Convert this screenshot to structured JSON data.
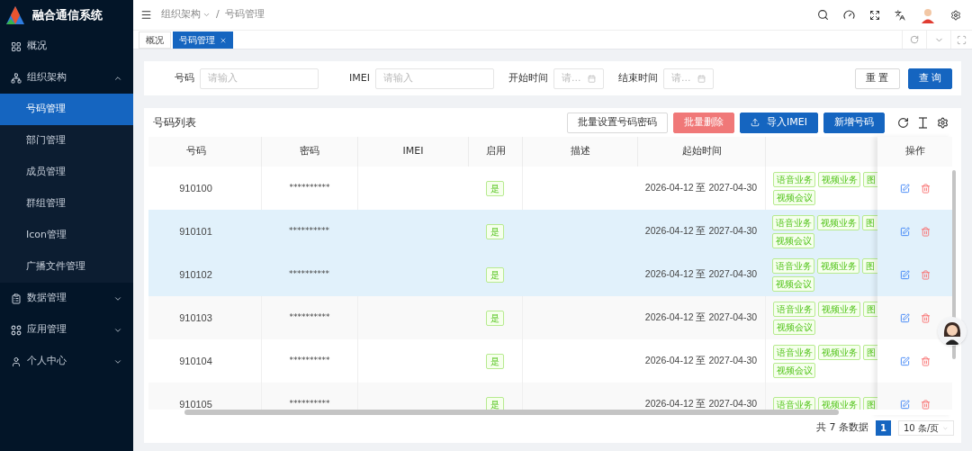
{
  "app": {
    "title": "融合通信系统"
  },
  "sidebar": {
    "items": [
      {
        "label": "概况",
        "selected": false
      },
      {
        "label": "组织架构",
        "selected": false,
        "expanded": true,
        "children": [
          {
            "label": "号码管理",
            "selected": true
          },
          {
            "label": "部门管理",
            "selected": false
          },
          {
            "label": "成员管理",
            "selected": false
          },
          {
            "label": "群组管理",
            "selected": false
          },
          {
            "label": "Icon管理",
            "selected": false
          },
          {
            "label": "广播文件管理",
            "selected": false
          }
        ]
      },
      {
        "label": "数据管理",
        "selected": false,
        "expanded": false
      },
      {
        "label": "应用管理",
        "selected": false,
        "expanded": false
      },
      {
        "label": "个人中心",
        "selected": false,
        "expanded": false
      }
    ]
  },
  "breadcrumb": {
    "items": [
      "组织架构",
      "号码管理"
    ],
    "separator": "/"
  },
  "tabs": [
    {
      "label": "概况",
      "selected": false,
      "closable": false
    },
    {
      "label": "号码管理",
      "selected": true,
      "closable": true
    }
  ],
  "search": {
    "fields": [
      {
        "label": "号码",
        "placeholder": "请输入",
        "kind": "text"
      },
      {
        "label": "IMEI",
        "placeholder": "请输入",
        "kind": "text"
      },
      {
        "label": "开始时间",
        "placeholder": "请...",
        "kind": "date"
      },
      {
        "label": "结束时间",
        "placeholder": "请...",
        "kind": "date"
      }
    ],
    "buttons": [
      {
        "label": "重 置",
        "kind": "default"
      },
      {
        "label": "查 询",
        "kind": "primary"
      }
    ]
  },
  "table": {
    "title": "号码列表",
    "toolbar": [
      {
        "label": "批量设置号码密码",
        "kind": "default"
      },
      {
        "label": "批量删除",
        "kind": "danger"
      },
      {
        "label": "导入IMEI",
        "kind": "upload"
      },
      {
        "label": "新增号码",
        "kind": "primary"
      }
    ],
    "columns": [
      "号码",
      "密码",
      "IMEI",
      "启用",
      "描述",
      "起始时间"
    ],
    "action_column": "操作",
    "rows": [
      {
        "number": "910100",
        "password": "**********",
        "enabled": "是",
        "period": "2026-04-12 至 2027-04-30",
        "services": [
          "语音业务",
          "视频业务",
          "图",
          "视频会议"
        ],
        "selected": false
      },
      {
        "number": "910101",
        "password": "**********",
        "enabled": "是",
        "period": "2026-04-12 至 2027-04-30",
        "services": [
          "语音业务",
          "视频业务",
          "图",
          "视频会议"
        ],
        "selected": true
      },
      {
        "number": "910102",
        "password": "**********",
        "enabled": "是",
        "period": "2026-04-12 至 2027-04-30",
        "services": [
          "语音业务",
          "视频业务",
          "图",
          "视频会议"
        ],
        "selected": true
      },
      {
        "number": "910103",
        "password": "**********",
        "enabled": "是",
        "period": "2026-04-12 至 2027-04-30",
        "services": [
          "语音业务",
          "视频业务",
          "图",
          "视频会议"
        ],
        "selected": false
      },
      {
        "number": "910104",
        "password": "**********",
        "enabled": "是",
        "period": "2026-04-12 至 2027-04-30",
        "services": [
          "语音业务",
          "视频业务",
          "图",
          "视频会议"
        ],
        "selected": false
      },
      {
        "number": "910105",
        "password": "**********",
        "enabled": "是",
        "period": "2026-04-12 至 2027-04-30",
        "services": [
          "语音业务",
          "视频业务",
          "图"
        ],
        "selected": false
      }
    ]
  },
  "pagination": {
    "total": "共 7 条数据",
    "pages": [
      {
        "label": "1",
        "selected": true
      }
    ],
    "page_size": "10 条/页"
  }
}
